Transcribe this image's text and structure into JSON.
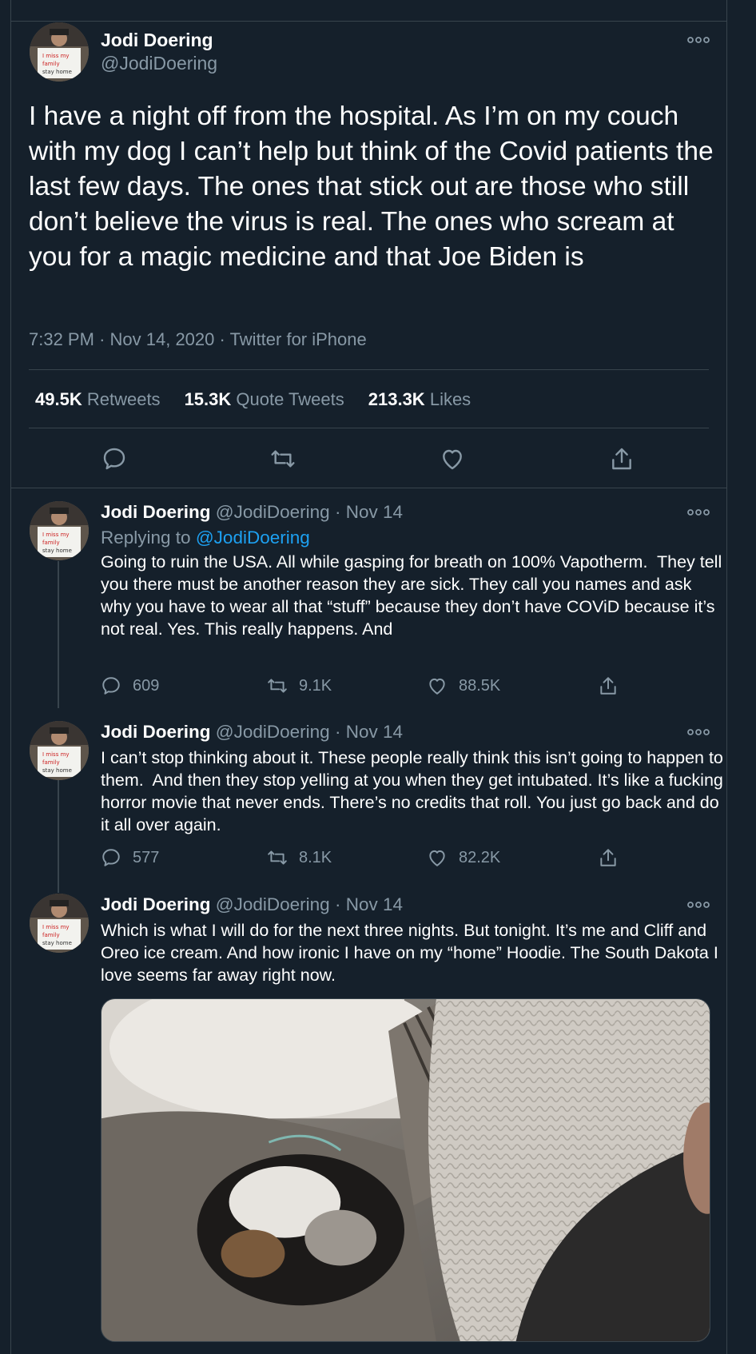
{
  "main_tweet": {
    "author_name": "Jodi Doering",
    "handle": "@JodiDoering",
    "text": "I have a night off from the hospital. As I’m on my couch with my dog I can’t help but think of the Covid patients the last few days. The ones that stick out are those who still don’t believe the virus is real. The ones who scream at you for a magic medicine and that Joe Biden is",
    "time": "7:32 PM",
    "date": "Nov 14, 2020",
    "source": "Twitter for iPhone",
    "retweets_count": "49.5K",
    "retweets_label": "Retweets",
    "quote_tweets_count": "15.3K",
    "quote_tweets_label": "Quote Tweets",
    "likes_count": "213.3K",
    "likes_label": "Likes"
  },
  "replies": [
    {
      "author_name": "Jodi Doering",
      "handle": "@JodiDoering",
      "date": "Nov 14",
      "replying_to_label": "Replying to",
      "replying_to_handle": "@JodiDoering",
      "text": "Going to ruin the USA. All while gasping for breath on 100% Vapotherm.  They tell you there must be another reason they are sick. They call you names and ask why you have to wear all that “stuff” because they don’t have COViD because it’s not real. Yes. This really happens. And",
      "replies": "609",
      "retweets": "9.1K",
      "likes": "88.5K"
    },
    {
      "author_name": "Jodi Doering",
      "handle": "@JodiDoering",
      "date": "Nov 14",
      "text": "I can’t stop thinking about it. These people really think this isn’t going to happen to them.  And then they stop yelling at you when they get intubated. It’s like a fucking horror movie that never ends. There’s no credits that roll. You just go back and do it all over again.",
      "replies": "577",
      "retweets": "8.1K",
      "likes": "82.2K"
    },
    {
      "author_name": "Jodi Doering",
      "handle": "@JodiDoering",
      "date": "Nov 14",
      "text": "Which is what I will do for the next three nights. But tonight. It’s me and Cliff and Oreo ice cream. And how ironic I have on my “home” Hoodie. The South Dakota I love seems far away right now."
    }
  ],
  "separator": "·",
  "colors": {
    "background": "#15202b",
    "border": "#38444d",
    "muted_text": "#8899a6",
    "link": "#1da1f2"
  },
  "icons": [
    "more-icon",
    "reply-icon",
    "retweet-icon",
    "like-icon",
    "share-icon"
  ]
}
